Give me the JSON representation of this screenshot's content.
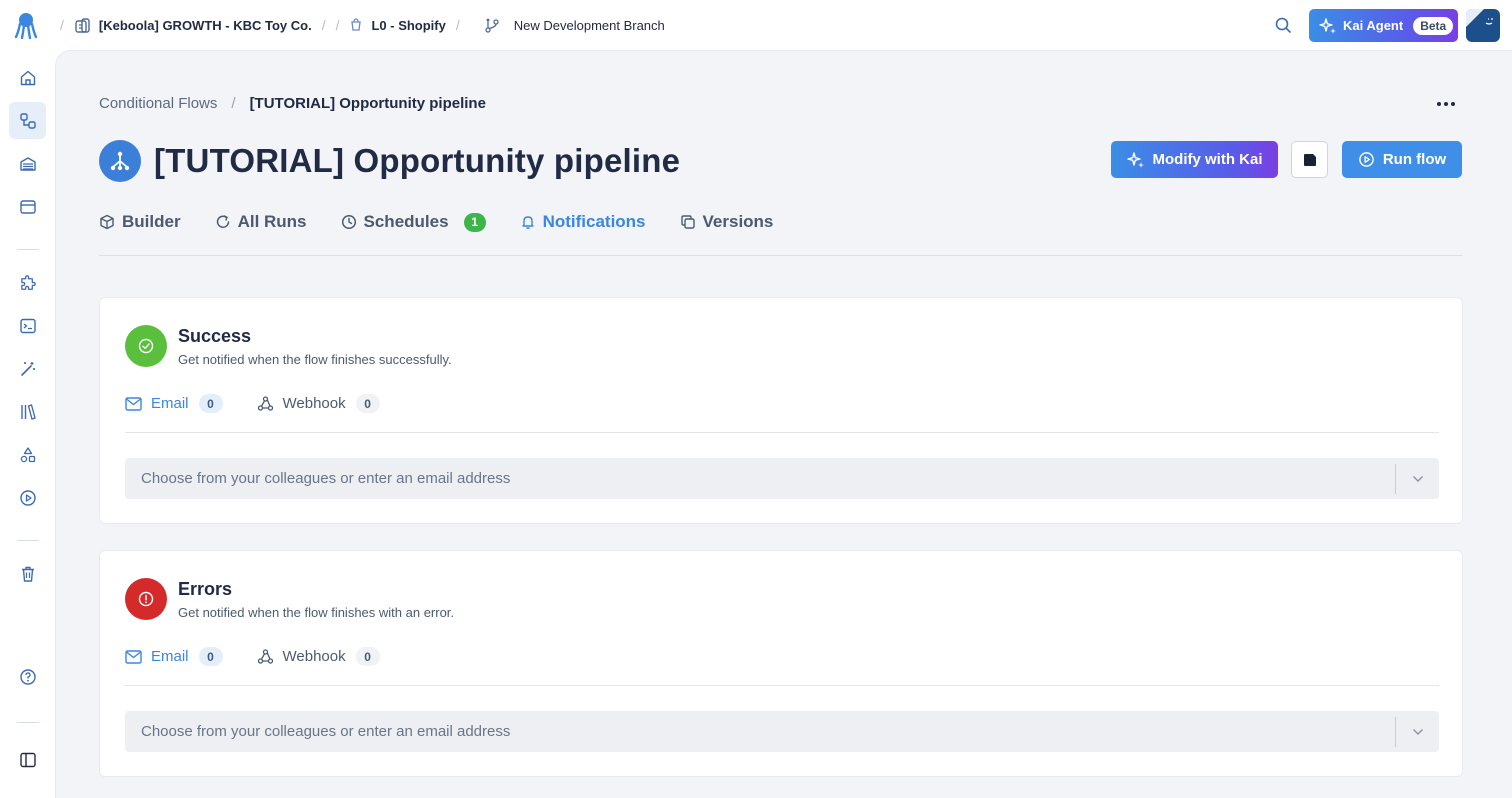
{
  "topbar": {
    "project": "[Keboola] GROWTH - KBC Toy Co.",
    "component": "L0 - Shopify",
    "branch": "New Development Branch",
    "kai_label": "Kai Agent",
    "kai_badge": "Beta"
  },
  "sidebar": {
    "items": [
      "home-icon",
      "flows-icon",
      "storage-icon",
      "components-icon",
      "puzzle-icon",
      "terminal-icon",
      "magic-wand-icon",
      "library-icon",
      "shapes-icon",
      "play-circle-icon",
      "trash-icon",
      "help-icon",
      "panel-toggle-icon"
    ],
    "active": "flows-icon"
  },
  "breadcrumb": {
    "parent": "Conditional Flows",
    "separator": "/",
    "current": "[TUTORIAL] Opportunity pipeline"
  },
  "page": {
    "title": "[TUTORIAL] Opportunity pipeline",
    "modify_label": "Modify with Kai",
    "run_label": "Run flow"
  },
  "tabs": [
    {
      "label": "Builder",
      "icon": "cube-icon"
    },
    {
      "label": "All Runs",
      "icon": "refresh-icon"
    },
    {
      "label": "Schedules",
      "icon": "clock-icon",
      "count": "1"
    },
    {
      "label": "Notifications",
      "icon": "bell-icon",
      "active": true
    },
    {
      "label": "Versions",
      "icon": "copy-icon"
    }
  ],
  "cards": [
    {
      "title": "Success",
      "description": "Get notified when the flow finishes successfully.",
      "email_label": "Email",
      "email_count": "0",
      "webhook_label": "Webhook",
      "webhook_count": "0",
      "placeholder": "Choose from your colleagues or enter an email address",
      "color": "#5bbf3e"
    },
    {
      "title": "Errors",
      "description": "Get notified when the flow finishes with an error.",
      "email_label": "Email",
      "email_count": "0",
      "webhook_label": "Webhook",
      "webhook_count": "0",
      "placeholder": "Choose from your colleagues or enter an email address",
      "color": "#d42a2a"
    }
  ],
  "colors": {
    "accent": "#3b86e0",
    "success_badge": "#3eb54a"
  }
}
